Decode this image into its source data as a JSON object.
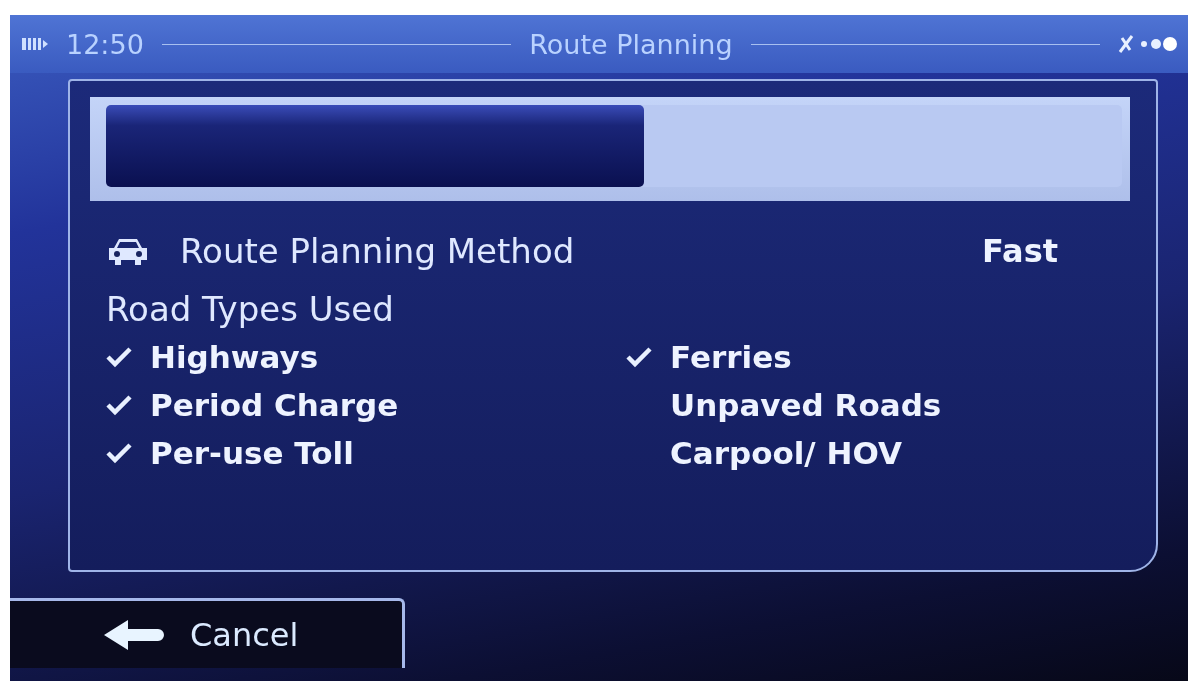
{
  "status_bar": {
    "time": "12:50",
    "title": "Route Planning"
  },
  "progress": {
    "level": 0.53
  },
  "method": {
    "label": "Route Planning Method",
    "value": "Fast"
  },
  "road_types": {
    "heading": "Road Types Used",
    "options": [
      {
        "label": "Highways",
        "checked": true
      },
      {
        "label": "Ferries",
        "checked": true
      },
      {
        "label": "Period Charge",
        "checked": true
      },
      {
        "label": "Unpaved Roads",
        "checked": false
      },
      {
        "label": "Per-use Toll",
        "checked": true
      },
      {
        "label": "Carpool/ HOV",
        "checked": false
      }
    ]
  },
  "cancel_button": {
    "label": "Cancel"
  }
}
